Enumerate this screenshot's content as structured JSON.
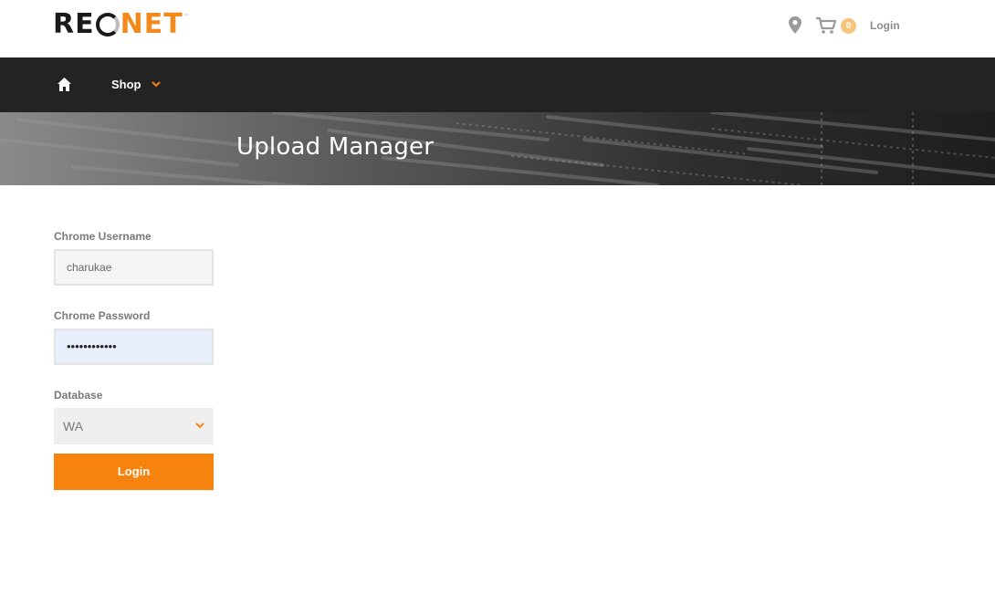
{
  "brand": {
    "logo_left": "RE",
    "logo_right": "NET",
    "logo_tm": "™",
    "accent": "#f28a1e"
  },
  "header": {
    "location_icon": "map-pin-icon",
    "cart_icon": "shopping-cart-icon",
    "cart_count": "0",
    "login_label": "Login"
  },
  "nav": {
    "home_icon": "home-icon",
    "shop_label": "Shop"
  },
  "banner": {
    "title": "Upload Manager"
  },
  "form": {
    "username_label": "Chrome Username",
    "username_value": "charukae",
    "password_label": "Chrome Password",
    "password_value": "••••••••••••",
    "database_label": "Database",
    "database_value": "WA",
    "submit_label": "Login"
  },
  "colors": {
    "nav_bg": "#232323",
    "button": "#f7830f",
    "badge": "#f7c47b"
  }
}
